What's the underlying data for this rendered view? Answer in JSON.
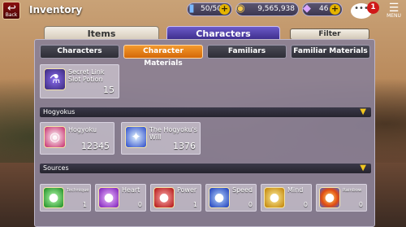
{
  "header": {
    "back_label": "Back",
    "title": "Inventory",
    "stamina": "50/50",
    "gold": "9,565,938",
    "gems": "46",
    "notifications": "1",
    "menu_label": "MENU"
  },
  "tabs": {
    "items": "Items",
    "characters": "Characters",
    "filter": "Filter"
  },
  "subtabs": [
    "Characters",
    "Character Materials",
    "Familiars",
    "Familiar Materials"
  ],
  "top_item": {
    "name_line1": "Secret Link",
    "name_line2": "Slot Potion",
    "qty": "15"
  },
  "hogyokus": {
    "title": "Hogyokus",
    "items": [
      {
        "name": "Hogyoku",
        "qty": "12345"
      },
      {
        "name_line1": "The Hogyoku's",
        "name_line2": "Will",
        "qty": "1376"
      }
    ]
  },
  "sources": {
    "title": "Sources",
    "items": [
      {
        "name": "Technique",
        "qty": "1",
        "color": "#2fd33a"
      },
      {
        "name": "Heart",
        "qty": "0",
        "color": "#b53ae8"
      },
      {
        "name": "Power",
        "qty": "1",
        "color": "#e82222"
      },
      {
        "name": "Speed",
        "qty": "0",
        "color": "#2a6cf0"
      },
      {
        "name": "Mind",
        "qty": "0",
        "color": "#f0b020"
      },
      {
        "name": "Rainbow",
        "qty": "0",
        "color": "#ff7a2a"
      }
    ]
  },
  "colors": {
    "active_tab": "#e07a14",
    "characters_tab": "#4d3da8",
    "accent_yellow": "#f0c520"
  }
}
